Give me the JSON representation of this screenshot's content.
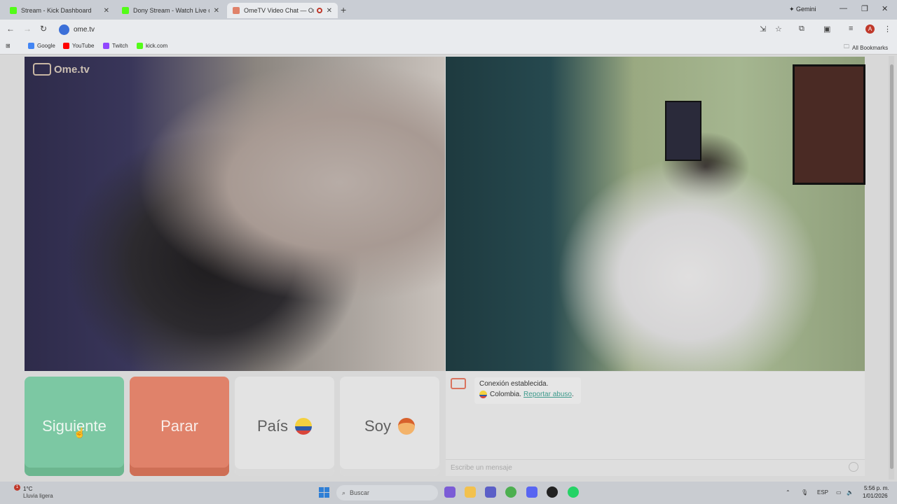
{
  "browser": {
    "tabs": [
      {
        "title": "Stream - Kick Dashboard",
        "favicon": "kick-icon",
        "color": "#53fc18"
      },
      {
        "title": "Dony Stream - Watch Live on K",
        "favicon": "kick-icon",
        "color": "#53fc18"
      },
      {
        "title": "OmeTV Video Chat — Ome",
        "favicon": "ometv-icon",
        "color": "#e0826a"
      }
    ],
    "new_tab": "+",
    "gemini_label": "Gemini",
    "url": "ome.tv",
    "bookmarks": [
      {
        "label": "Google",
        "icon": "google-icon",
        "color": "#4285f4"
      },
      {
        "label": "YouTube",
        "icon": "youtube-icon",
        "color": "#ff0000"
      },
      {
        "label": "Twitch",
        "icon": "twitch-icon",
        "color": "#9146ff"
      },
      {
        "label": "kick.com",
        "icon": "kick-icon",
        "color": "#53fc18"
      }
    ],
    "all_bookmarks": "All Bookmarks",
    "profile_initial": "A"
  },
  "app": {
    "watermark": "Ome.tv",
    "buttons": {
      "next": "Siguiente",
      "stop": "Parar",
      "country": "País",
      "soy": "Soy"
    },
    "chat": {
      "status": "Conexión establecida.",
      "country": "Colombia.",
      "report_link": "Reportar abuso",
      "report_tail": ".",
      "input_placeholder": "Escribe un mensaje"
    },
    "colors": {
      "next": "#7cc8a3",
      "stop": "#e0826a"
    }
  },
  "taskbar": {
    "weather_temp": "1°C",
    "weather_desc": "Lluvia ligera",
    "weather_badge": "1",
    "search_placeholder": "Buscar",
    "lang": "ESP",
    "time": "5:56 p. m.",
    "date": "1/01/2026"
  }
}
